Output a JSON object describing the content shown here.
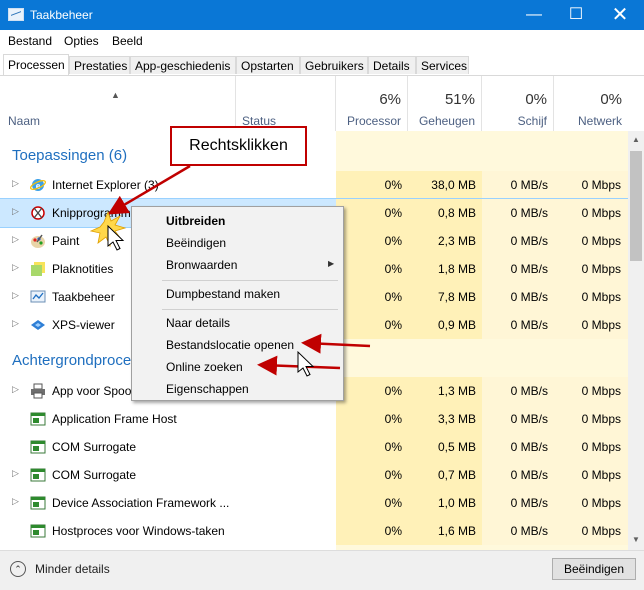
{
  "window": {
    "title": "Taakbeheer"
  },
  "menu": [
    "Bestand",
    "Opties",
    "Beeld"
  ],
  "tabs": [
    "Processen",
    "Prestaties",
    "App-geschiedenis",
    "Opstarten",
    "Gebruikers",
    "Details",
    "Services"
  ],
  "header": {
    "name": "Naam",
    "status": "Status",
    "cpu_pct": "6%",
    "cpu_label": "Processor",
    "mem_pct": "51%",
    "mem_label": "Geheugen",
    "disk_pct": "0%",
    "disk_label": "Schijf",
    "net_pct": "0%",
    "net_label": "Netwerk"
  },
  "sections": {
    "apps": "Toepassingen (6)",
    "background": "Achtergrondprocessen"
  },
  "apps": [
    {
      "name": "Internet Explorer (3)",
      "cpu": "0%",
      "mem": "38,0 MB",
      "disk": "0 MB/s",
      "net": "0 Mbps",
      "icon": "internet-explorer-icon"
    },
    {
      "name": "Knipprogramma",
      "cpu": "0%",
      "mem": "0,8 MB",
      "disk": "0 MB/s",
      "net": "0 Mbps",
      "icon": "snipping-tool-icon"
    },
    {
      "name": "Paint",
      "cpu": "0%",
      "mem": "2,3 MB",
      "disk": "0 MB/s",
      "net": "0 Mbps",
      "icon": "paint-icon"
    },
    {
      "name": "Plaknotities",
      "cpu": "0%",
      "mem": "1,8 MB",
      "disk": "0 MB/s",
      "net": "0 Mbps",
      "icon": "sticky-notes-icon"
    },
    {
      "name": "Taakbeheer",
      "cpu": "0%",
      "mem": "7,8 MB",
      "disk": "0 MB/s",
      "net": "0 Mbps",
      "icon": "task-manager-icon"
    },
    {
      "name": "XPS-viewer",
      "cpu": "0%",
      "mem": "0,9 MB",
      "disk": "0 MB/s",
      "net": "0 Mbps",
      "icon": "xps-viewer-icon"
    }
  ],
  "background": [
    {
      "name": "App voor Spoo",
      "cpu": "0%",
      "mem": "1,3 MB",
      "disk": "0 MB/s",
      "net": "0 Mbps",
      "icon": "printer-icon"
    },
    {
      "name": "Application Frame Host",
      "cpu": "0%",
      "mem": "3,3 MB",
      "disk": "0 MB/s",
      "net": "0 Mbps",
      "icon": "app-window-icon"
    },
    {
      "name": "COM Surrogate",
      "cpu": "0%",
      "mem": "0,5 MB",
      "disk": "0 MB/s",
      "net": "0 Mbps",
      "icon": "app-window-icon"
    },
    {
      "name": "COM Surrogate",
      "cpu": "0%",
      "mem": "0,7 MB",
      "disk": "0 MB/s",
      "net": "0 Mbps",
      "icon": "app-window-icon"
    },
    {
      "name": "Device Association Framework ...",
      "cpu": "0%",
      "mem": "1,0 MB",
      "disk": "0 MB/s",
      "net": "0 Mbps",
      "icon": "app-window-icon"
    },
    {
      "name": "Hostproces voor Windows-taken",
      "cpu": "0%",
      "mem": "1,6 MB",
      "disk": "0 MB/s",
      "net": "0 Mbps",
      "icon": "app-window-icon"
    }
  ],
  "context_menu": {
    "expand": "Uitbreiden",
    "end_task": "Beëindigen",
    "resource_values": "Bronwaarden",
    "dump": "Dumpbestand maken",
    "go_details": "Naar details",
    "open_location": "Bestandslocatie openen",
    "search_online": "Online zoeken",
    "properties": "Eigenschappen"
  },
  "callout": "Rechtsklikken",
  "footer": {
    "fewer_details": "Minder details",
    "end_button": "Beëindigen"
  },
  "colors": {
    "titlebar": "#0a77d6",
    "section": "#1f6fbf",
    "highlight": "#fff4c4",
    "selected_row": "#cce8ff",
    "annotation": "#c00000"
  }
}
